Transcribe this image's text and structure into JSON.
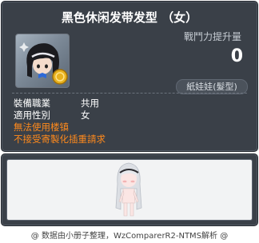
{
  "item_id": "00048820",
  "tooltip": {
    "title": "黑色休闲发带发型 （女）",
    "attack_label": "戰鬥力提升量",
    "attack_value": "0",
    "category": "紙娃娃(髮型)",
    "properties": [
      {
        "key": "裝備職業",
        "value": "共用"
      },
      {
        "key": "適用性別",
        "value": "女"
      }
    ],
    "warnings": [
      "無法使用楼镇",
      "不接受寄製化插重請求"
    ]
  },
  "icons": {
    "hair_icon": "hair-icon",
    "gold_coin": "coin-icon",
    "character_preview": "character-preview"
  },
  "footer": "@ 数据由小册子整理，WzComparerR2-NTMS解析 @",
  "colors": {
    "panel_bg": "#3a4048",
    "warning_text": "#ff8a1c",
    "text_white": "#ffffff"
  }
}
